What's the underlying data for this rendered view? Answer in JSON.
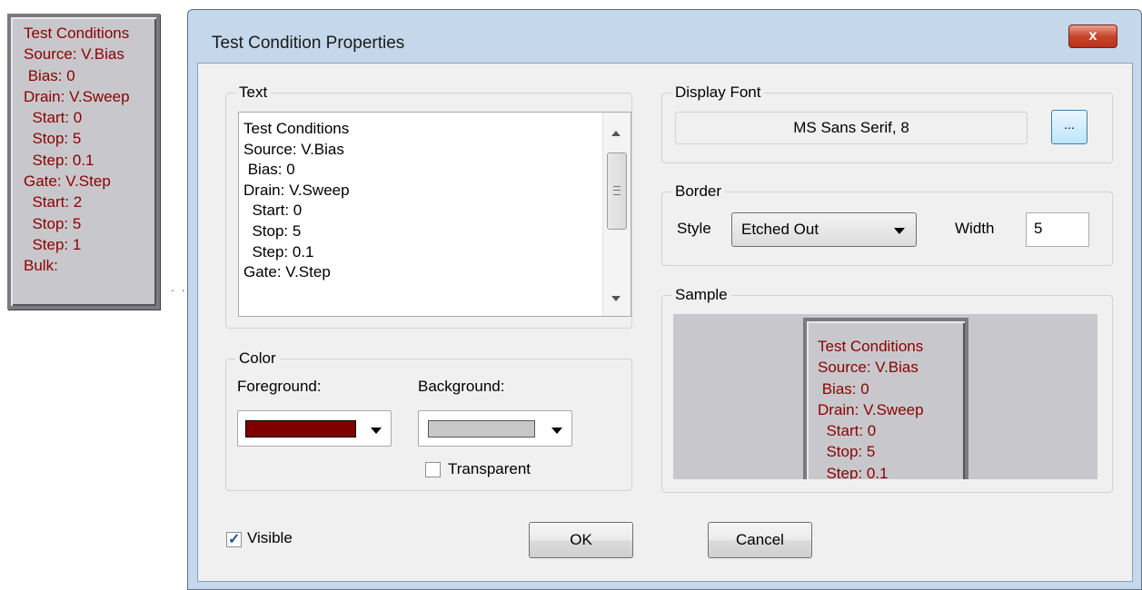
{
  "annotation": {
    "lines": [
      "Test Conditions",
      "Source: V.Bias",
      " Bias: 0",
      "Drain: V.Sweep",
      "  Start: 0",
      "  Stop: 5",
      "  Step: 0.1",
      "Gate: V.Step",
      "  Start: 2",
      "  Stop: 5",
      "  Step: 1",
      "Bulk:"
    ],
    "connector": ". ."
  },
  "dialog": {
    "title": "Test Condition Properties",
    "close_label": "x"
  },
  "text_group": {
    "label": "Text",
    "lines": [
      "Test Conditions",
      "Source: V.Bias",
      " Bias: 0",
      "Drain: V.Sweep",
      "  Start: 0",
      "  Stop: 5",
      "  Step: 0.1",
      "Gate: V.Step"
    ]
  },
  "display_font": {
    "label": "Display Font",
    "value": "MS Sans Serif, 8",
    "button_label": "..."
  },
  "border": {
    "label": "Border",
    "style_label": "Style",
    "style_value": "Etched Out",
    "width_label": "Width",
    "width_value": "5"
  },
  "color": {
    "label": "Color",
    "foreground_label": "Foreground:",
    "background_label": "Background:",
    "foreground_color": "#800000",
    "background_color": "#c8c8c8",
    "transparent_label": "Transparent",
    "transparent_checked": false
  },
  "sample": {
    "label": "Sample",
    "lines": [
      "Test Conditions",
      "Source: V.Bias",
      " Bias: 0",
      "Drain: V.Sweep",
      "  Start: 0",
      "  Stop: 5",
      "  Step: 0.1"
    ]
  },
  "footer": {
    "visible_label": "Visible",
    "visible_checked": true,
    "ok_label": "OK",
    "cancel_label": "Cancel"
  }
}
